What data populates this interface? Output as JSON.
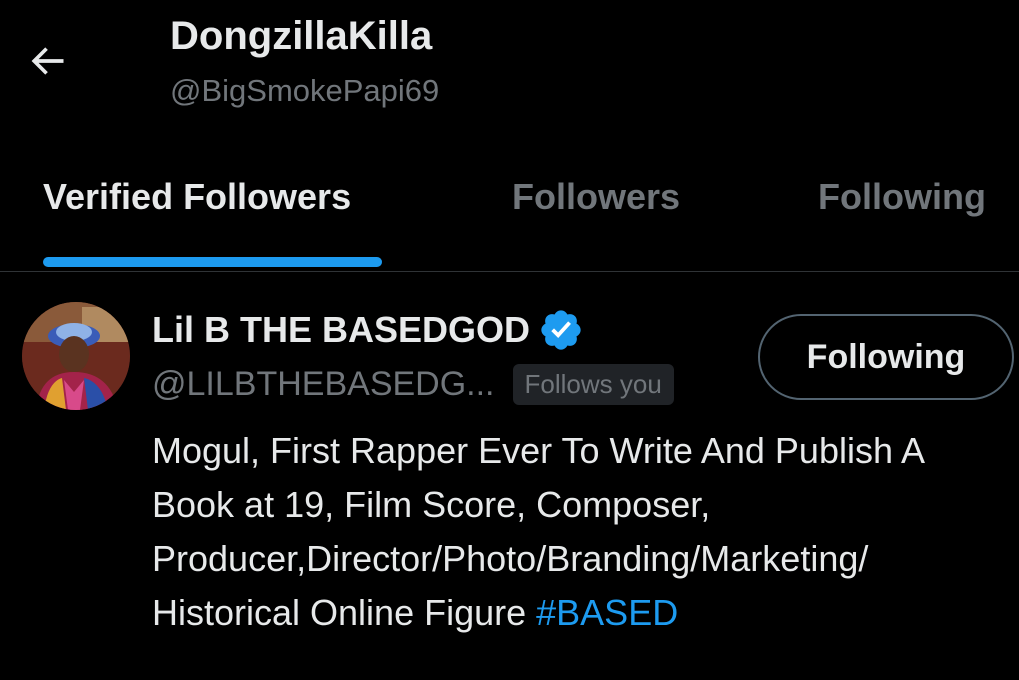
{
  "header": {
    "display_name": "DongzillaKilla",
    "handle": "@BigSmokePapi69",
    "back_icon": "arrow-left-icon"
  },
  "tabs": [
    {
      "label": "Verified Followers",
      "active": true
    },
    {
      "label": "Followers",
      "active": false
    },
    {
      "label": "Following",
      "active": false
    }
  ],
  "user": {
    "name": "Lil B THE BASEDGOD",
    "verified_icon": "verified-badge-icon",
    "handle": "@LILBTHEBASEDG...",
    "follows_you_label": "Follows you",
    "follow_button_label": "Following",
    "bio_text": "Mogul, First Rapper Ever To Write And Publish A Book at 19, Film Score, Composer, Producer,Director/Photo/Branding/Marketing/ Historical Online Figure ",
    "bio_hashtag": "#BASED"
  },
  "colors": {
    "background": "#000000",
    "accent": "#1d9bf0",
    "primary_text": "#e7e9ea",
    "secondary_text": "#71767b"
  }
}
